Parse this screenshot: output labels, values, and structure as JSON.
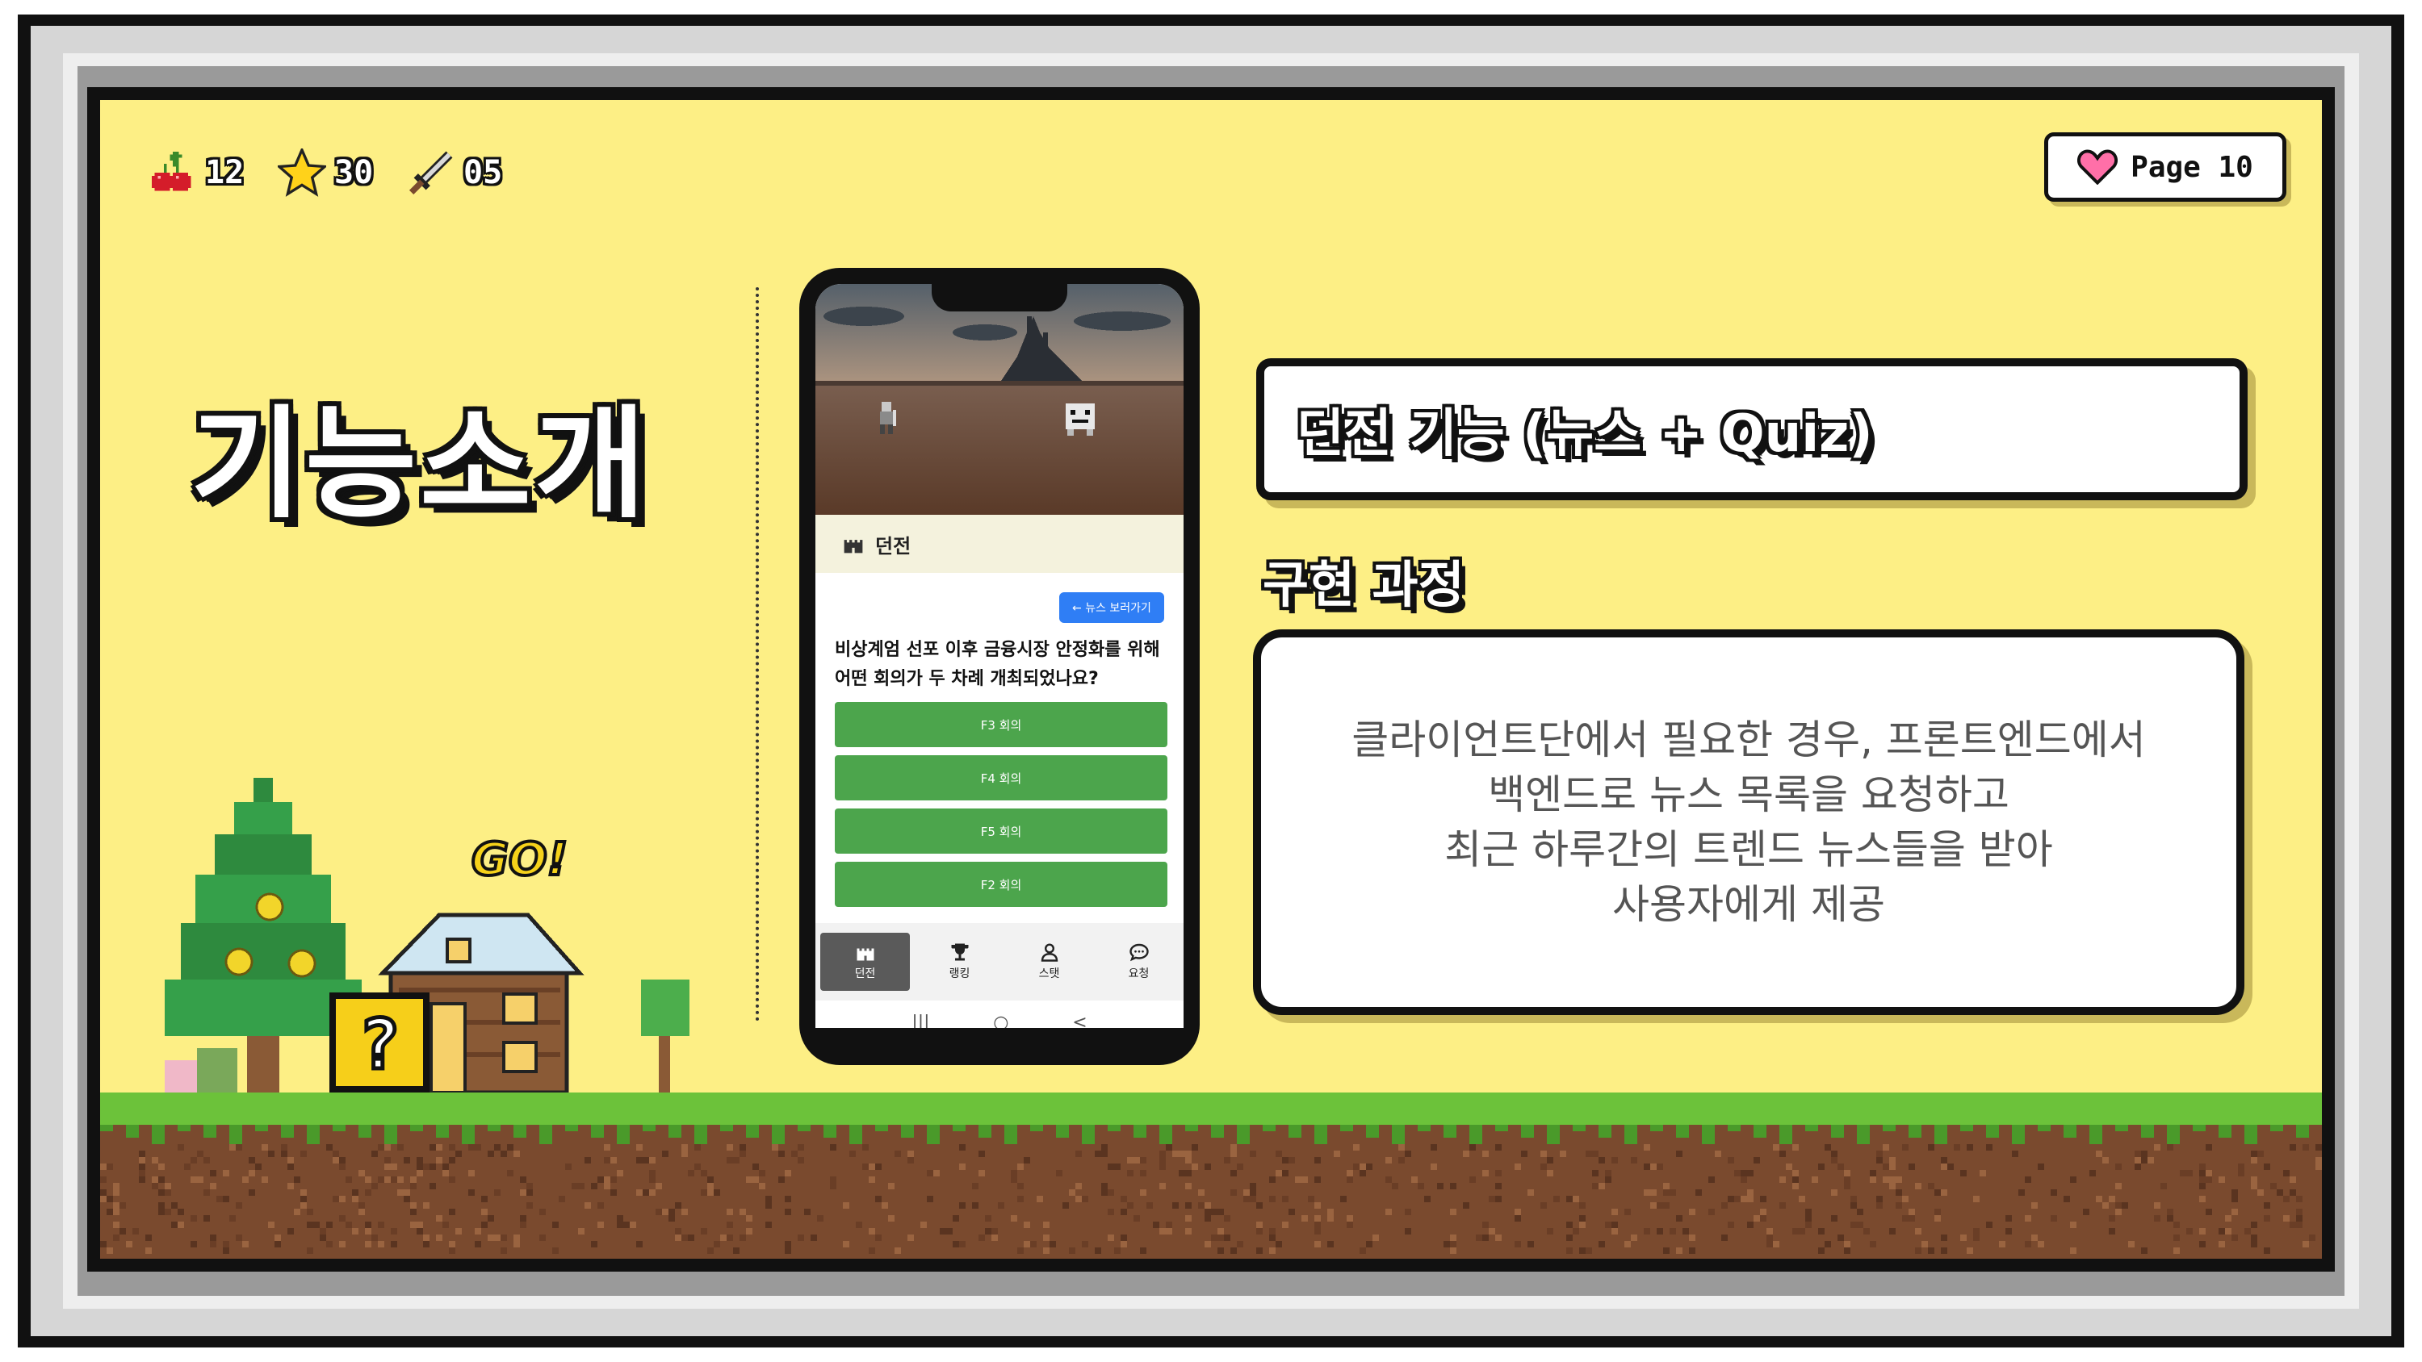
{
  "hud": {
    "cherries": "12",
    "stars": "30",
    "swords": "05"
  },
  "page_badge": "Page 10",
  "title": "기능소개",
  "phone": {
    "header_title": "던전",
    "news_back_button": "← 뉴스 보러가기",
    "question": "비상계엄 선포 이후 금융시장 안정화를 위해 어떤 회의가 두 차례 개최되었나요?",
    "options": [
      "F3 회의",
      "F4 회의",
      "F5 회의",
      "F2 회의"
    ],
    "nav": [
      {
        "label": "던전",
        "icon": "castle-icon"
      },
      {
        "label": "랭킹",
        "icon": "trophy-icon"
      },
      {
        "label": "스탯",
        "icon": "person-icon"
      },
      {
        "label": "요청",
        "icon": "chat-icon"
      }
    ],
    "sys_buttons": [
      "|||",
      "○",
      "<"
    ]
  },
  "feature_title": "던전 기능 (뉴스 + Quiz)",
  "process_label": "구현 과정",
  "description": [
    "클라이언트단에서 필요한 경우, 프론트엔드에서",
    "백엔드로 뉴스 목록을 요청하고",
    "최근 하루간의 트렌드 뉴스들을 받아",
    "사용자에게 제공"
  ],
  "go_sign": "GO!",
  "colors": {
    "background": "#fdef85",
    "option_green": "#4ca54c",
    "button_blue": "#2f7ef5",
    "grass": "#6cc23a",
    "dirt": "#7a4a2e"
  }
}
